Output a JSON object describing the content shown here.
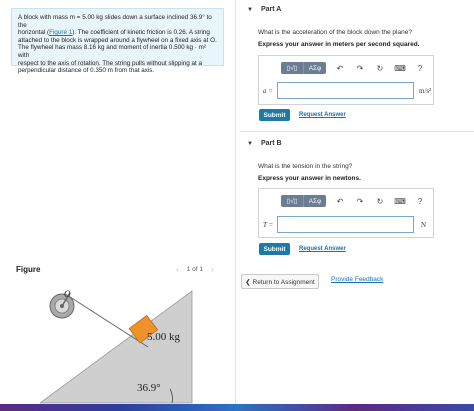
{
  "problem": {
    "line1": "A block with mass m = 5.00 kg slides down a surface inclined 36.9° to the",
    "line2_pre": "horizontal (",
    "figure_link": "Figure 1",
    "line2_post": "). The coefficient of kinetic friction is 0.26. A string",
    "line3": "attached to the block is wrapped around a flywheel on a fixed axis at O.",
    "line4": "The flywheel has mass 8.16 kg and moment of inertia 0.500 kg · m² with",
    "line5": "respect to the axis of rotation. The string pulls without slipping at a",
    "line6": "perpendicular distance of 0.350 m from that axis."
  },
  "figure": {
    "label": "Figure",
    "pager_text": "1 of 1",
    "prev_icon": "‹",
    "next_icon": "›",
    "pivot_label": "O",
    "mass_label": "5.00 kg",
    "angle_label": "36.9°"
  },
  "toolbar": {
    "templates_label": "▯√▯",
    "greek_label": "ΑΣφ",
    "undo_icon": "↶",
    "redo_icon": "↷",
    "reset_icon": "↻",
    "keyboard_icon": "⌨",
    "help_icon": "?"
  },
  "partA": {
    "title": "Part A",
    "question": "What is the acceleration of the block down the plane?",
    "instruction": "Express your answer in meters per second squared.",
    "var_label": "a =",
    "unit": "m/s²",
    "answer_value": "",
    "submit_label": "Submit",
    "request_label": "Request Answer"
  },
  "partB": {
    "title": "Part B",
    "question": "What is the tension in the string?",
    "instruction": "Express your answer in newtons.",
    "var_label": "T =",
    "unit": "N",
    "answer_value": "",
    "submit_label": "Submit",
    "request_label": "Request Answer"
  },
  "footer": {
    "return_label": "❮ Return to Assignment",
    "feedback_label": "Provide Feedback"
  },
  "colors": {
    "accent": "#1d7aa6",
    "link": "#1a6fb5",
    "block": "#f0922b",
    "ramp": "#cfcfcf"
  }
}
